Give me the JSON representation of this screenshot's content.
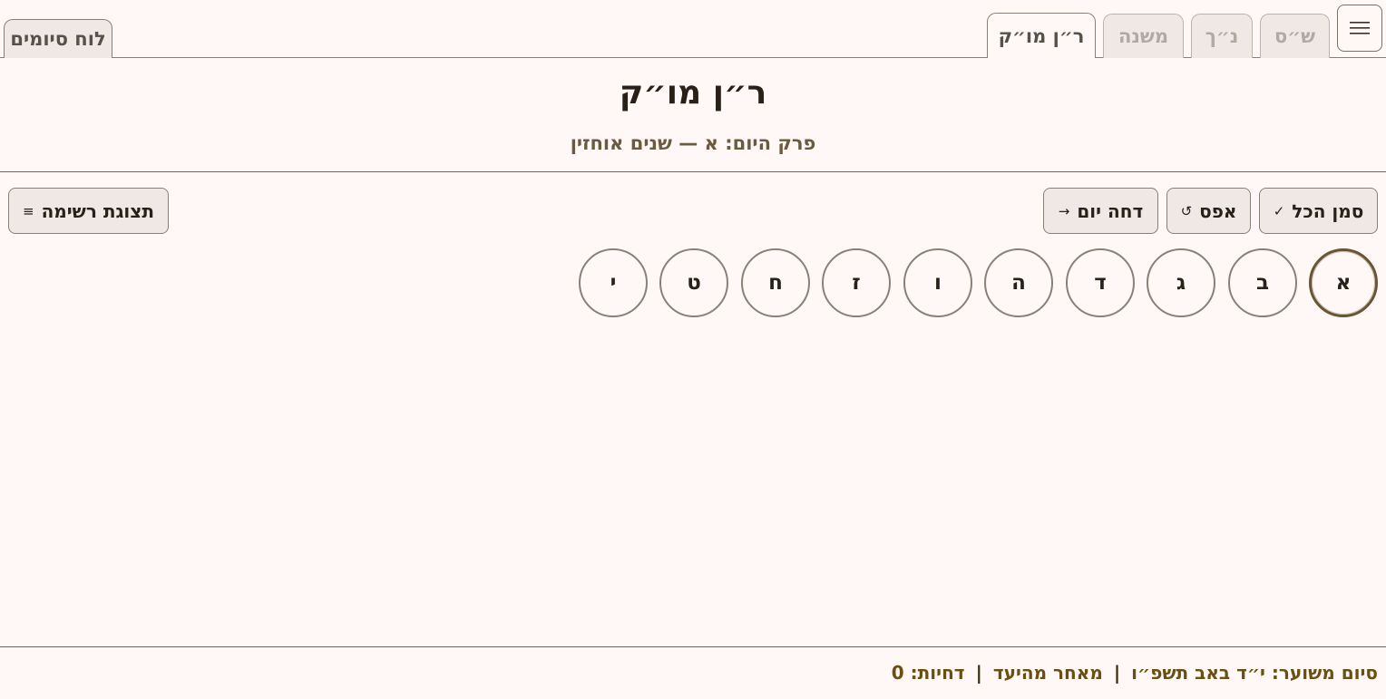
{
  "tabs": [
    {
      "label": "ש״ס",
      "active": false
    },
    {
      "label": "נ״ך",
      "active": false
    },
    {
      "label": "משנה",
      "active": false
    },
    {
      "label": "ר״ן מו״ק",
      "active": true
    }
  ],
  "siyum_tab": {
    "label": "לוח סיומים"
  },
  "header": {
    "title": "ר״ן מו״ק",
    "subtitle": "פרק היום: א — שנים אוחזין"
  },
  "toolbar": {
    "mark_all_label": "סמן הכל",
    "mark_all_icon": "✓",
    "reset_label": "אפס",
    "reset_icon": "↺",
    "postpone_label": "דחה יום",
    "postpone_icon": "→",
    "list_view_label": "תצוגת רשימה",
    "list_view_icon": "≡"
  },
  "chapters": [
    "א",
    "ב",
    "ג",
    "ד",
    "ה",
    "ו",
    "ז",
    "ח",
    "ט",
    "י"
  ],
  "current_chapter": "א",
  "footer": {
    "expected_siyum": "סיום משוער: י״ד באב תשפ״ו",
    "status": "מאחר מהיעד",
    "postponements": "דחיות: 0"
  }
}
